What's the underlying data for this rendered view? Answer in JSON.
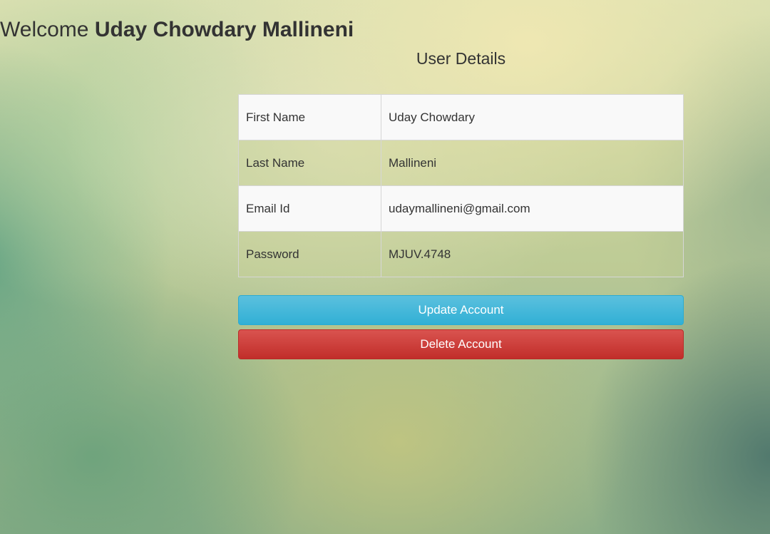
{
  "header": {
    "welcome_prefix": "Welcome",
    "user_name": "Uday Chowdary Mallineni"
  },
  "details": {
    "title": "User Details",
    "rows": [
      {
        "label": "First Name",
        "value": "Uday Chowdary"
      },
      {
        "label": "Last Name",
        "value": "Mallineni"
      },
      {
        "label": "Email Id",
        "value": "udaymallineni@gmail.com"
      },
      {
        "label": "Password",
        "value": "MJUV.4748"
      }
    ]
  },
  "actions": {
    "update_label": "Update Account",
    "delete_label": "Delete Account",
    "update_color": "#5bc0de",
    "delete_color": "#d9534f"
  }
}
